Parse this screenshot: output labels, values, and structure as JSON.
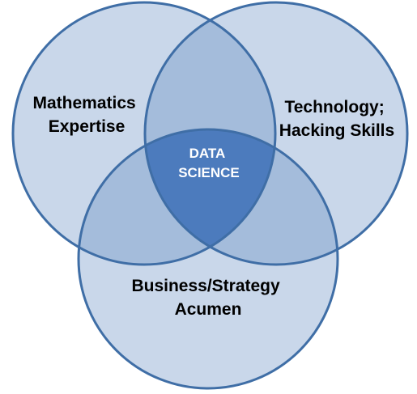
{
  "diagram": {
    "sets": [
      {
        "id": "math",
        "lines": [
          "Mathematics",
          "Expertise"
        ]
      },
      {
        "id": "tech",
        "lines": [
          "Technology;",
          "Hacking Skills"
        ]
      },
      {
        "id": "business",
        "lines": [
          "Business/Strategy",
          "Acumen"
        ]
      }
    ],
    "intersection": {
      "lines": [
        "DATA",
        "SCIENCE"
      ]
    },
    "colors": {
      "circle_fill": "#c9d7ea",
      "circle_stroke": "#3f6ea6",
      "pair_overlap_fill": "#a4bcdb",
      "center_fill": "#4c7bbd",
      "center_text": "#ffffff",
      "label_text": "#000000"
    }
  }
}
